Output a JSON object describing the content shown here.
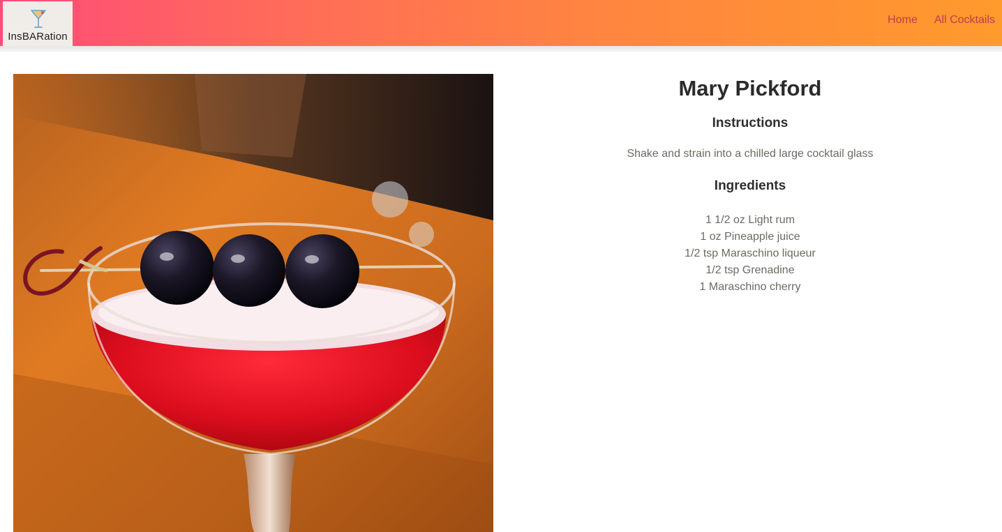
{
  "navbar": {
    "brand": "InsBARation",
    "links": [
      "Home",
      "All Cocktails"
    ],
    "gradient": [
      "#fe4b7a",
      "#ff9a2c"
    ],
    "link_color": "#b83e4e"
  },
  "cocktail": {
    "name": "Mary Pickford",
    "instructions_heading": "Instructions",
    "instructions": "Shake and strain into a chilled large cocktail glass",
    "ingredients_heading": "Ingredients",
    "ingredients": [
      "1 1/2 oz Light rum",
      "1 oz Pineapple juice",
      "1/2 tsp Maraschino liqueur",
      "1/2 tsp Grenadine",
      "1 Maraschino cherry"
    ]
  }
}
